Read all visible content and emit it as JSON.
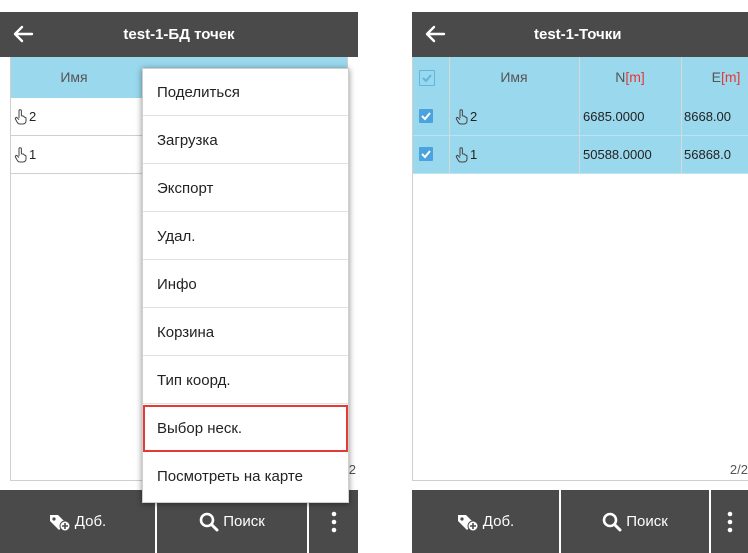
{
  "left": {
    "title": "test-1-БД точек",
    "table": {
      "col_name": "Имя",
      "rows": [
        {
          "name": "2"
        },
        {
          "name": "1"
        }
      ]
    },
    "page_indicator": "2/2",
    "menu": [
      "Поделиться",
      "Загрузка",
      "Экспорт",
      "Удал.",
      "Инфо",
      "Корзина",
      "Тип коорд.",
      "Выбор неск.",
      "Посмотреть на карте"
    ],
    "highlighted_menu_item": "Выбор неск.",
    "bottombar": {
      "add": "Доб.",
      "search": "Поиск"
    }
  },
  "right": {
    "title": "test-1-Точки",
    "table": {
      "col_name": "Имя",
      "col_n": "N",
      "col_n_unit": "[m]",
      "col_e": "E",
      "col_e_unit": "[m]",
      "rows": [
        {
          "name": "2",
          "n": "6685.0000",
          "e": "8668.00",
          "checked": true
        },
        {
          "name": "1",
          "n": "50588.0000",
          "e": "56868.0",
          "checked": true
        }
      ]
    },
    "page_indicator": "2/2",
    "bottombar": {
      "add": "Доб.",
      "search": "Поиск"
    }
  },
  "icons": {
    "back": "arrow-left-icon",
    "point": "hand-point-icon",
    "add": "tag-plus-icon",
    "search": "search-icon",
    "more": "more-vert-icon",
    "checkbox": "checkbox-icon"
  },
  "colors": {
    "titlebar": "#4a4a4a",
    "table_header": "#9ad8ee",
    "selected_row": "#9ad8ee",
    "checkbox": "#4aa3df",
    "unit": "#e53935",
    "highlight": "#e53935"
  }
}
